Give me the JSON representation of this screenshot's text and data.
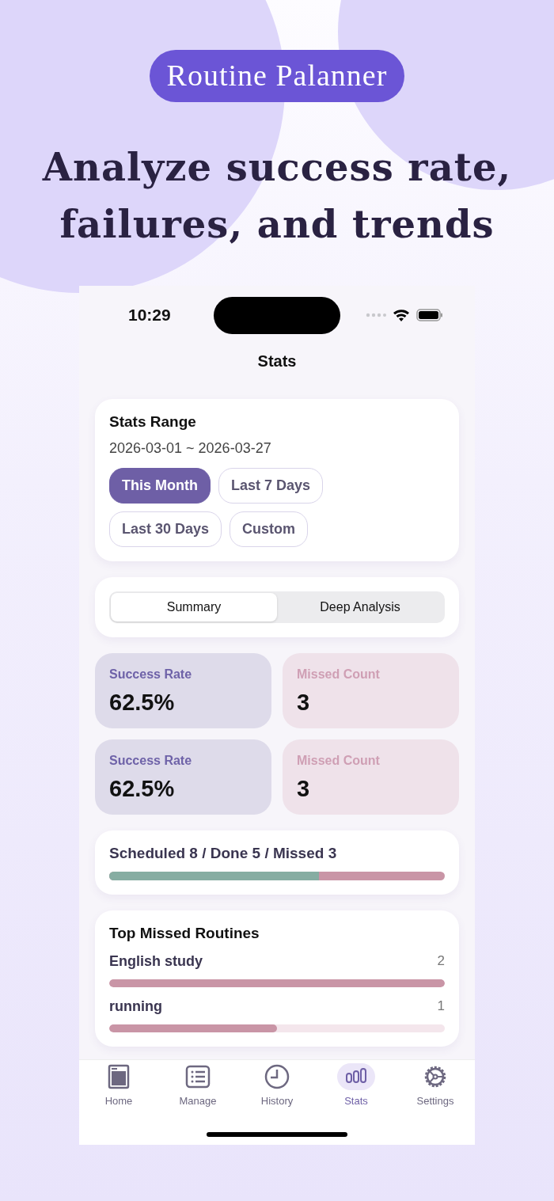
{
  "app_badge": "Routine Palanner",
  "headline": [
    "Analyze success rate,",
    "failures, and trends"
  ],
  "status_bar": {
    "time": "10:29"
  },
  "screen_title": "Stats",
  "stats_range": {
    "title": "Stats Range",
    "dates": "2026-03-01 ~ 2026-03-27",
    "options": [
      {
        "label": "This Month",
        "selected": true
      },
      {
        "label": "Last 7 Days",
        "selected": false
      },
      {
        "label": "Last 30 Days",
        "selected": false
      },
      {
        "label": "Custom",
        "selected": false
      }
    ]
  },
  "segments": [
    {
      "label": "Summary",
      "selected": true
    },
    {
      "label": "Deep Analysis",
      "selected": false
    }
  ],
  "stat_cards": [
    {
      "kind": "success",
      "label": "Success Rate",
      "value": "62.5%"
    },
    {
      "kind": "missed",
      "label": "Missed Count",
      "value": "3"
    },
    {
      "kind": "success",
      "label": "Success Rate",
      "value": "62.5%"
    },
    {
      "kind": "missed",
      "label": "Missed Count",
      "value": "3"
    }
  ],
  "summary": {
    "text": "Scheduled 8 / Done 5 / Missed 3",
    "level": 0.625
  },
  "top_missed": {
    "title": "Top Missed Routines",
    "items": [
      {
        "name": "English study",
        "count": "2",
        "level": 1
      },
      {
        "name": "running",
        "count": "1",
        "level": 0.5
      }
    ]
  },
  "tab_bar": [
    {
      "kind": "home",
      "label": "Home",
      "selected": false
    },
    {
      "kind": "manage",
      "label": "Manage",
      "selected": false
    },
    {
      "kind": "history",
      "label": "History",
      "selected": false
    },
    {
      "kind": "stats",
      "label": "Stats",
      "selected": true
    },
    {
      "kind": "settings",
      "label": "Settings",
      "selected": false
    }
  ]
}
